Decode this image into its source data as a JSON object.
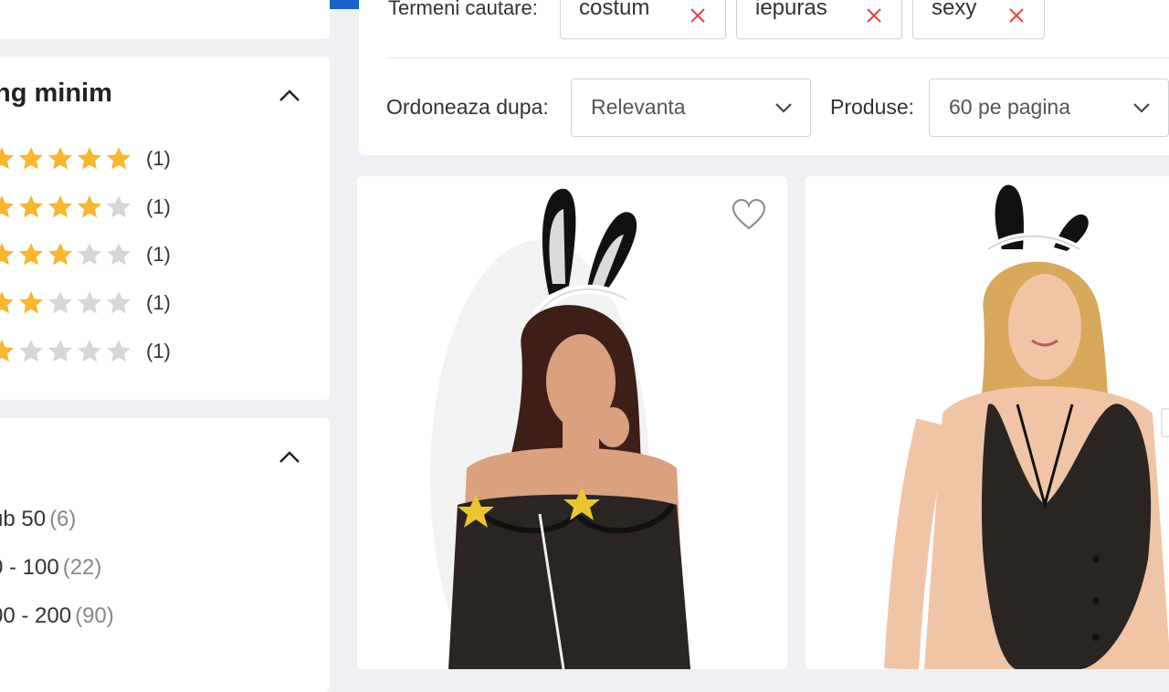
{
  "colors": {
    "brand_blue": "#1a63c6",
    "star_filled": "#f7b731",
    "star_empty": "#d5d7da",
    "chip_x": "#e0433c"
  },
  "sidebar": {
    "rating_section": {
      "title": "ng minim",
      "rows": [
        {
          "stars": 5,
          "count": "(1)"
        },
        {
          "stars": 4,
          "count": "(1)"
        },
        {
          "stars": 3,
          "count": "(1)"
        },
        {
          "stars": 2,
          "count": "(1)"
        },
        {
          "stars": 1,
          "count": "(1)"
        }
      ]
    },
    "price_section": {
      "rows": [
        {
          "label": "ub 50",
          "count": "(6)"
        },
        {
          "label": "0 - 100",
          "count": "(22)"
        },
        {
          "label": "00 - 200",
          "count": "(90)"
        }
      ]
    }
  },
  "filters": {
    "search_terms_label": "Termeni cautare:",
    "chips": [
      "costum",
      "iepuras",
      "sexy"
    ]
  },
  "sorting": {
    "order_label": "Ordoneaza dupa:",
    "order_value": "Relevanta",
    "per_page_label": "Produse:",
    "per_page_value": "60 pe pagina"
  },
  "icons": {
    "chevron_up": "chevron-up-icon",
    "chevron_down": "chevron-down-icon",
    "remove": "close-icon",
    "favorite": "heart-icon",
    "star": "star-icon"
  }
}
